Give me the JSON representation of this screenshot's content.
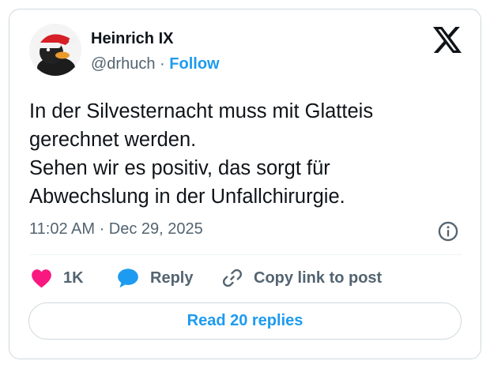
{
  "author": {
    "name": "Heinrich IX",
    "handle": "@drhuch",
    "separator": "·",
    "follow_label": "Follow",
    "avatar": "rubber-duck-with-santa-hat"
  },
  "tweet": {
    "lines": [
      "In der Silvesternacht muss mit Glatteis",
      "gerechnet werden.",
      "Sehen wir es positiv, das sorgt für",
      "Abwechslung in der Unfallchirurgie."
    ],
    "timestamp": "11:02 AM · Dec 29, 2025"
  },
  "actions": {
    "like_count": "1K",
    "reply_label": "Reply",
    "copy_label": "Copy link to post"
  },
  "footer": {
    "read_replies_label": "Read 20 replies"
  },
  "icons": {
    "brand": "x-logo",
    "info": "info-icon",
    "like": "heart-icon",
    "reply": "speech-bubble-icon",
    "copy": "link-icon"
  },
  "colors": {
    "text": "#0f1419",
    "secondary": "#536471",
    "accent": "#1d9bf0",
    "like": "#f91880",
    "border": "#cfd9de"
  }
}
